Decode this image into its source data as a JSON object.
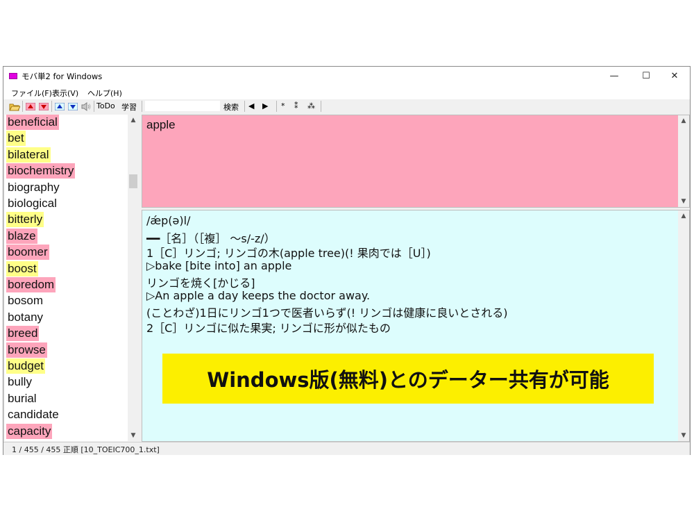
{
  "window": {
    "title": "モバ単2 for Windows",
    "controls": {
      "minimize": "—",
      "maximize": "☐",
      "close": "✕"
    }
  },
  "menu": [
    "ファイル(F)",
    "表示(V)",
    "ヘルプ(H)"
  ],
  "toolbar": {
    "todo_label": "ToDo",
    "study_label": "学習",
    "search_label": "検索",
    "search_value": "",
    "prev_glyph": "◀",
    "next_glyph": "▶",
    "star1": "*",
    "star2": "⁑",
    "star3": "⁂"
  },
  "word_list": [
    {
      "word": "beneficial",
      "color": "#fda5bb"
    },
    {
      "word": "bet",
      "color": "#ffff88"
    },
    {
      "word": "bilateral",
      "color": "#ffff88"
    },
    {
      "word": "biochemistry",
      "color": "#fda5bb"
    },
    {
      "word": "biography",
      "color": ""
    },
    {
      "word": "biological",
      "color": ""
    },
    {
      "word": "bitterly",
      "color": "#ffff88"
    },
    {
      "word": "blaze",
      "color": "#fda5bb"
    },
    {
      "word": "boomer",
      "color": "#fda5bb"
    },
    {
      "word": "boost",
      "color": "#ffff88"
    },
    {
      "word": "boredom",
      "color": "#fda5bb"
    },
    {
      "word": "bosom",
      "color": ""
    },
    {
      "word": "botany",
      "color": ""
    },
    {
      "word": "breed",
      "color": "#fda5bb"
    },
    {
      "word": "browse",
      "color": "#fda5bb"
    },
    {
      "word": "budget",
      "color": "#ffff88"
    },
    {
      "word": "bully",
      "color": ""
    },
    {
      "word": "burial",
      "color": ""
    },
    {
      "word": "candidate",
      "color": ""
    },
    {
      "word": "capacity",
      "color": "#fda5bb"
    }
  ],
  "current_word": "apple",
  "definition_lines": [
    "/ǽp(ə)l/",
    "━━［名］（［複］ ～s/-z/）",
    "1［C］リンゴ; リンゴの木(apple tree)(! 果肉では［U］)",
    "▷bake [bite into] an apple",
    "リンゴを焼く[かじる]",
    "▷An apple a day keeps the doctor away.",
    "(ことわざ)1日にリンゴ1つで医者いらず(! リンゴは健康に良いとされる)",
    "2［C］リンゴに似た果実; リンゴに形が似たもの"
  ],
  "banner_text": "Windows版(無料)とのデーター共有が可能",
  "status": "1 / 455 / 455 正順 [10_TOEIC700_1.txt]",
  "colors": {
    "word_pane": "#fda5bb",
    "definition_pane": "#ddfdfd",
    "banner": "#fcef00",
    "highlight_pink": "#fda5bb",
    "highlight_yellow": "#ffff88"
  }
}
